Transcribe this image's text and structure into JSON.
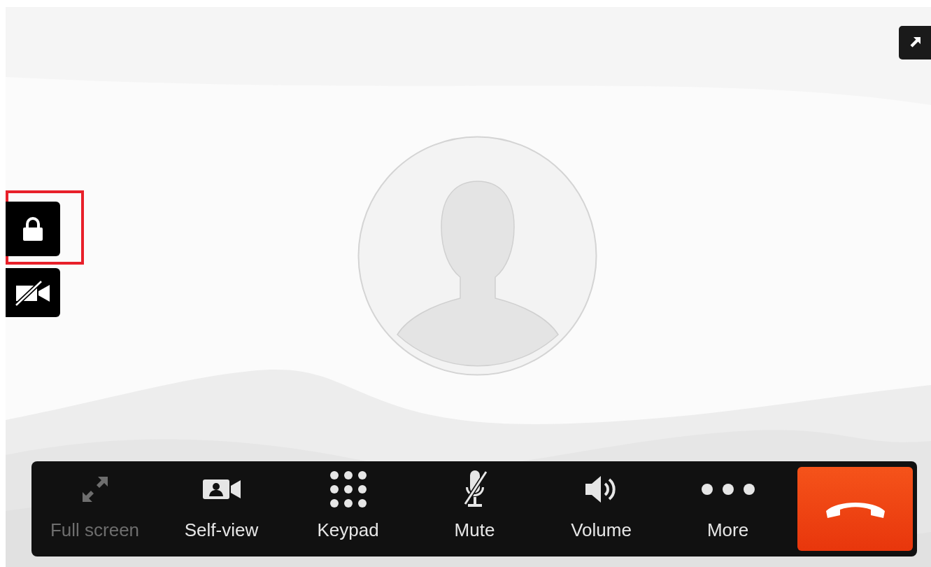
{
  "toolbar": {
    "buttons": [
      {
        "label": "Full screen",
        "disabled": true
      },
      {
        "label": "Self-view",
        "disabled": false
      },
      {
        "label": "Keypad",
        "disabled": false
      },
      {
        "label": "Mute",
        "disabled": false
      },
      {
        "label": "Volume",
        "disabled": false
      },
      {
        "label": "More",
        "disabled": false
      }
    ]
  }
}
